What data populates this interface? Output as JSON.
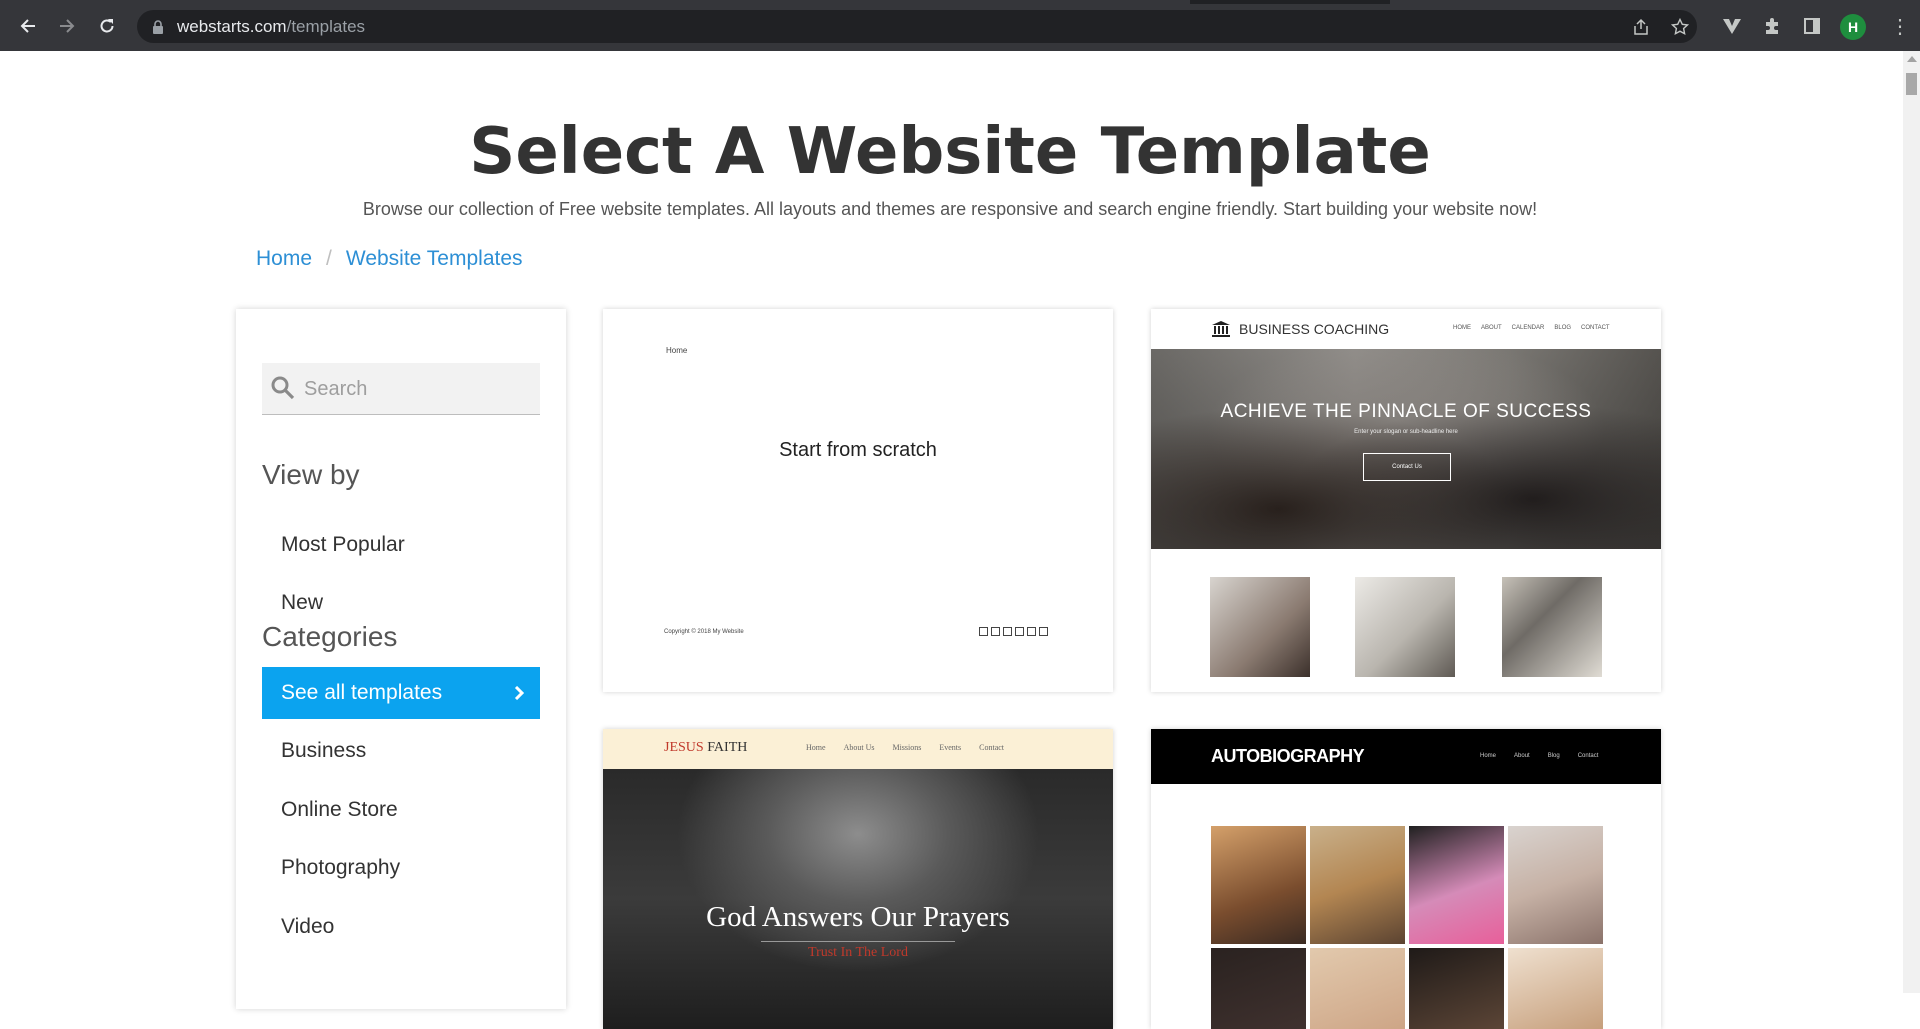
{
  "browser": {
    "url_domain": "webstarts.com",
    "url_path": "/templates",
    "profile_initial": "H"
  },
  "page": {
    "title": "Select A Website Template",
    "subtitle": "Browse our collection of Free website templates. All layouts and themes are responsive and search engine friendly. Start building your website now!",
    "breadcrumb": {
      "home": "Home",
      "separator": "/",
      "current": "Website Templates"
    }
  },
  "sidebar": {
    "search_placeholder": "Search",
    "view_by_heading": "View by",
    "view_by_items": [
      "Most Popular",
      "New"
    ],
    "categories_heading": "Categories",
    "categories": [
      {
        "label": "See all templates",
        "active": true
      },
      {
        "label": "Business",
        "active": false
      },
      {
        "label": "Online Store",
        "active": false
      },
      {
        "label": "Photography",
        "active": false
      },
      {
        "label": "Video",
        "active": false
      }
    ]
  },
  "templates": {
    "scratch": {
      "nav_home": "Home",
      "center_text": "Start from scratch",
      "copyright": "Copyright © 2018 My Website"
    },
    "business_coaching": {
      "logo_text": "BUSINESS COACHING",
      "nav": [
        "HOME",
        "ABOUT",
        "CALENDAR",
        "BLOG",
        "CONTACT"
      ],
      "hero_title": "ACHIEVE THE PINNACLE OF SUCCESS",
      "hero_subtitle": "Enter your slogan or sub-headline here",
      "hero_button": "Contact Us"
    },
    "jesus_faith": {
      "logo_first": "JESUS",
      "logo_rest": " FAITH",
      "nav": [
        "Home",
        "About Us",
        "Missions",
        "Events",
        "Contact"
      ],
      "hero_title": "God Answers Our Prayers",
      "hero_subtitle": "Trust In The Lord"
    },
    "autobiography": {
      "logo_text": "AUTOBIOGRAPHY",
      "nav": [
        "Home",
        "About",
        "Blog",
        "Contact"
      ]
    }
  },
  "colors": {
    "accent": "#0ba3ef",
    "link": "#2d8fd5",
    "title": "#333333"
  }
}
